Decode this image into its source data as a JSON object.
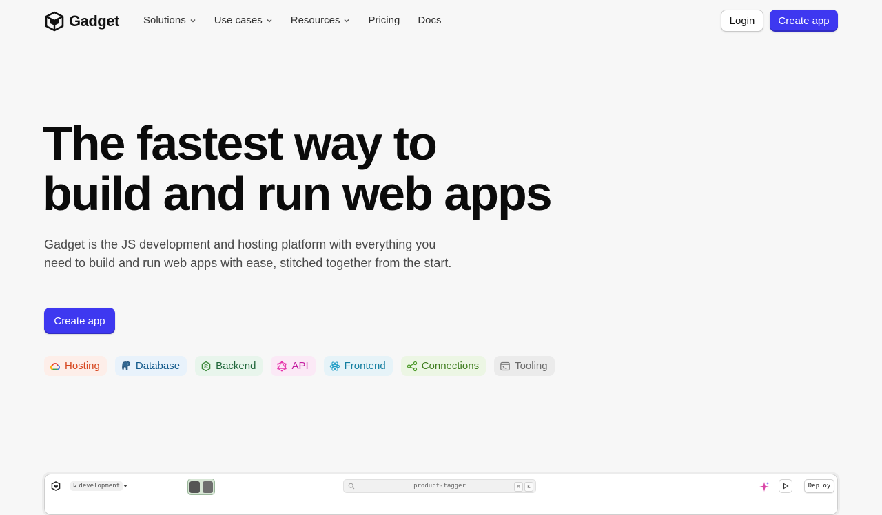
{
  "brand": {
    "name": "Gadget",
    "logo_icon": "gadget-cube-icon"
  },
  "nav": {
    "items": [
      {
        "label": "Solutions",
        "has_dropdown": true
      },
      {
        "label": "Use cases",
        "has_dropdown": true
      },
      {
        "label": "Resources",
        "has_dropdown": true
      },
      {
        "label": "Pricing",
        "has_dropdown": false
      },
      {
        "label": "Docs",
        "has_dropdown": false
      }
    ],
    "login_label": "Login",
    "create_app_label": "Create app"
  },
  "hero": {
    "title_line1": "The fastest way to",
    "title_line2": "build and run web apps",
    "subtitle": "Gadget is the JS development and hosting platform with everything you need to build and run web apps with ease, stitched together from the start.",
    "cta_label": "Create app"
  },
  "features": [
    {
      "label": "Hosting",
      "icon": "cloud-icon"
    },
    {
      "label": "Database",
      "icon": "postgres-elephant-icon"
    },
    {
      "label": "Backend",
      "icon": "nodejs-hexagon-icon"
    },
    {
      "label": "API",
      "icon": "graphql-icon"
    },
    {
      "label": "Frontend",
      "icon": "react-atom-icon"
    },
    {
      "label": "Connections",
      "icon": "connections-nodes-icon"
    },
    {
      "label": "Tooling",
      "icon": "terminal-icon"
    }
  ],
  "colors": {
    "accent": "#3e38f0",
    "background": "#f7f7f7",
    "hosting": "#d6461f",
    "database": "#125a8c",
    "backend": "#21683c",
    "api": "#c41fa1",
    "frontend": "#137ea0",
    "connections": "#3f7d1f",
    "tooling": "#6b6b6b"
  },
  "preview": {
    "branch": "development",
    "search_text": "product-tagger",
    "kbd_cmd": "⌘",
    "kbd_k": "K",
    "deploy_label": "Deploy"
  }
}
